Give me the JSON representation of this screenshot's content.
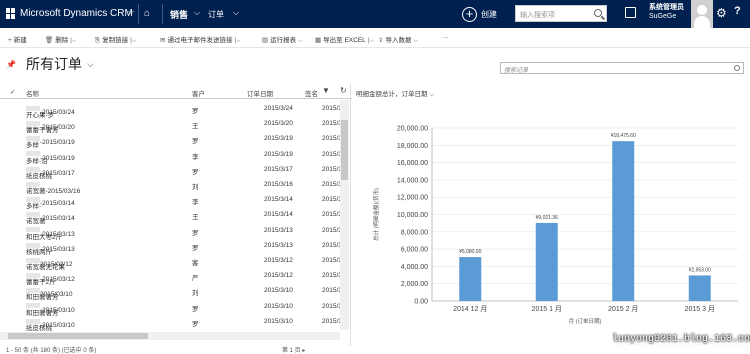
{
  "topbar": {
    "app_title": "Microsoft Dynamics CRM",
    "area": "销售",
    "entity": "订单",
    "create_label": "创建",
    "search_placeholder": "输入搜索项",
    "user_name": "系统管理员",
    "user_org": "SuGeGe"
  },
  "commands": [
    {
      "label": "新建",
      "icon": "plus-icon"
    },
    {
      "label": "删除",
      "icon": "trash-icon"
    },
    {
      "label": "复制链接",
      "icon": "link-icon"
    },
    {
      "label": "通过电子邮件发送链接",
      "icon": "email-icon"
    },
    {
      "label": "运行报表",
      "icon": "report-icon"
    },
    {
      "label": "导出至 EXCEL",
      "icon": "excel-icon"
    },
    {
      "label": "导入数据",
      "icon": "import-icon"
    },
    {
      "label": "···",
      "icon": "more-icon"
    }
  ],
  "view": {
    "title": "所有订单",
    "search_placeholder": "搜索记录"
  },
  "grid": {
    "columns": [
      "名称",
      "客户",
      "订单日期",
      "签名"
    ],
    "rows": [
      {
        "name": "开心果-罗",
        "name2": "-2015/03/24",
        "customer": "罗",
        "date": "2015/3/24",
        "sign": "2015/3"
      },
      {
        "name": "蕾蕾干著芳",
        "name2": "-2015/03/20",
        "customer": "王",
        "date": "2015/3/20",
        "sign": "2015/3"
      },
      {
        "name": "多样",
        "name2": "-2015/03/19",
        "customer": "罗",
        "date": "2015/3/19",
        "sign": "2015/3"
      },
      {
        "name": "多样-沿",
        "name2": "-2015/03/19",
        "customer": "李",
        "date": "2015/3/19",
        "sign": "2015/3"
      },
      {
        "name": "纸皮核桃",
        "name2": "-2015/03/17",
        "customer": "罗",
        "date": "2015/3/17",
        "sign": "2015/3"
      },
      {
        "name": "诺宽著-2015/03/16",
        "name2": "",
        "customer": "刘",
        "date": "2015/3/16",
        "sign": "2015/3"
      },
      {
        "name": "多样-",
        "name2": "-2015/03/14",
        "customer": "李",
        "date": "2015/3/14",
        "sign": "2015/3"
      },
      {
        "name": "诺宽著",
        "name2": "-2015/03/14",
        "customer": "王",
        "date": "2015/3/14",
        "sign": "2015/3"
      },
      {
        "name": "和田大枣2斤",
        "name2": "-2015/03/13",
        "customer": "罗",
        "date": "2015/3/13",
        "sign": "2015/3"
      },
      {
        "name": "核桃两斤",
        "name2": "-2015/03/13",
        "customer": "罗",
        "date": "2015/3/13",
        "sign": "2015/3"
      },
      {
        "name": "诺宽著无花果",
        "name2": "2015/03/12",
        "customer": "客",
        "date": "2015/3/12",
        "sign": "2015/3"
      },
      {
        "name": "蕾蕾干2斤",
        "name2": "-2015/03/12",
        "customer": "严",
        "date": "2015/3/12",
        "sign": "2015/3"
      },
      {
        "name": "和田著著芳",
        "name2": "2015/03/10",
        "customer": "刘",
        "date": "2015/3/10",
        "sign": "2015/3"
      },
      {
        "name": "和田著著芳",
        "name2": "-2015/03/10",
        "customer": "罗",
        "date": "2015/3/10",
        "sign": "2015/3"
      },
      {
        "name": "纸皮核桃",
        "name2": "-2015/03/10",
        "customer": "罗",
        "date": "2015/3/10",
        "sign": "2015/3"
      }
    ],
    "footer": "1 - 50 条 (共 180 条) (已选中 0 条)",
    "pager": "第 1 页"
  },
  "chart_data": {
    "type": "bar",
    "title": "明细金额总计，订单日期",
    "categories": [
      "2014 12 月",
      "2015 1 月",
      "2015 2 月",
      "2015 3 月"
    ],
    "values": [
      5080,
      9021.36,
      18475.6,
      2953
    ],
    "data_labels": [
      "¥5,080.00",
      "¥9,021.36",
      "¥18,475.60",
      "¥2,953.00"
    ],
    "yticks": [
      "20,000.00",
      "18,000.00",
      "16,000.00",
      "14,000.00",
      "12,000.00",
      "10,000.00",
      "8,000.00",
      "6,000.00",
      "4,000.00",
      "2,000.00",
      "0.00"
    ],
    "ylim": [
      0,
      20000
    ],
    "xlabel": "月 (订单日期)",
    "ylabel": "总计 (明细金额)(货币)",
    "bar_color": "#5b9bd5",
    "grid": true
  },
  "watermark": "luoyong0201.blog.163.com"
}
